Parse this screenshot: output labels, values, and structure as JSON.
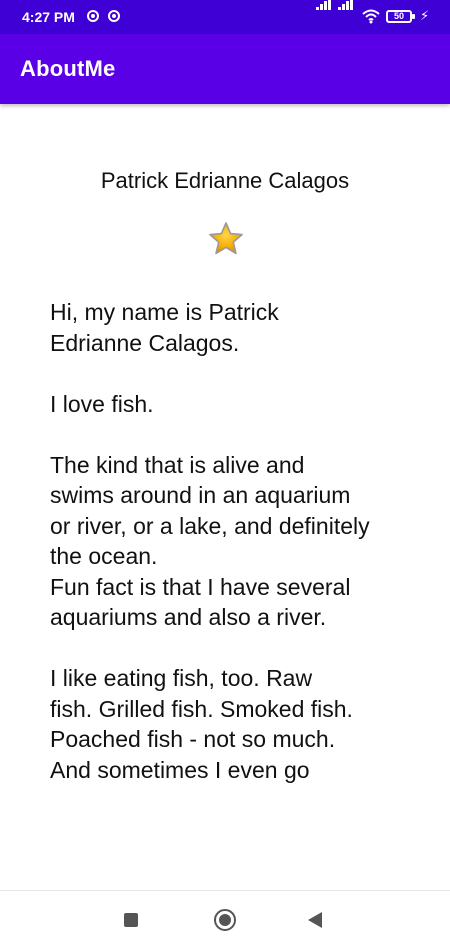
{
  "status_bar": {
    "time": "4:27 PM",
    "battery_level": "50",
    "color": "#3f00d6"
  },
  "app_bar": {
    "title": "AboutMe",
    "color": "#5a00e6"
  },
  "profile": {
    "name": "Patrick Edrianne Calagos",
    "star_icon": "star-icon",
    "bio": "Hi, my name is Patrick\nEdrianne Calagos.\n\nI love fish.\n\nThe kind that is alive and\nswims around in an aquarium\nor river, or a lake, and definitely\nthe ocean.\nFun fact is that I have several\naquariums and also a river.\n\nI like eating fish, too. Raw\nfish. Grilled fish. Smoked fish.\nPoached fish - not so much.\nAnd sometimes I even go"
  },
  "nav_bar": {
    "recents_icon": "square-icon",
    "home_icon": "circle-icon",
    "back_icon": "triangle-back-icon"
  }
}
